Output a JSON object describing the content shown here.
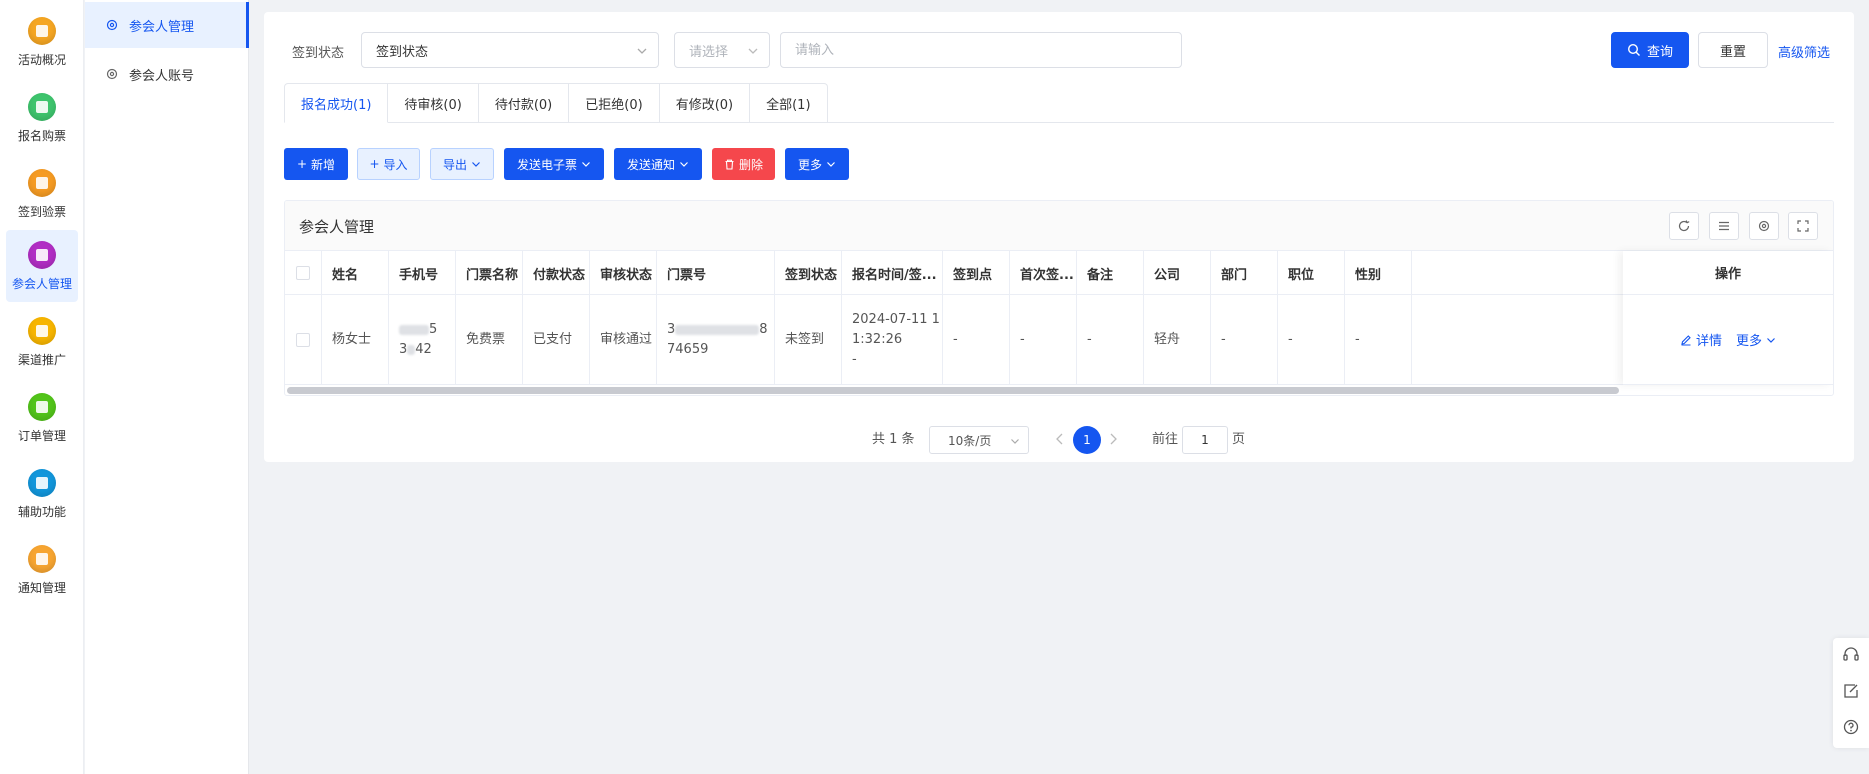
{
  "rail": {
    "items": [
      {
        "label": "活动概况",
        "color": "#f5a623",
        "active": false
      },
      {
        "label": "报名购票",
        "color": "#3ec46d",
        "active": false
      },
      {
        "label": "签到验票",
        "color": "#f59b23",
        "active": false
      },
      {
        "label": "参会人管理",
        "color": "#b12ec4",
        "active": true
      },
      {
        "label": "渠道推广",
        "color": "#f7b500",
        "active": false
      },
      {
        "label": "订单管理",
        "color": "#52c41a",
        "active": false
      },
      {
        "label": "辅助功能",
        "color": "#1296db",
        "active": false
      },
      {
        "label": "通知管理",
        "color": "#f7a531",
        "active": false
      }
    ]
  },
  "subnav": {
    "items": [
      {
        "label": "参会人管理",
        "active": true
      },
      {
        "label": "参会人账号",
        "active": false
      }
    ]
  },
  "filter": {
    "label": "签到状态",
    "status_select": "签到状态",
    "type_select": "请选择",
    "keyword_placeholder": "请输入",
    "search_label": "查询",
    "reset_label": "重置",
    "advanced_label": "高级筛选"
  },
  "tabs": [
    {
      "label": "报名成功(1)",
      "active": true
    },
    {
      "label": "待审核(0)",
      "active": false
    },
    {
      "label": "待付款(0)",
      "active": false
    },
    {
      "label": "已拒绝(0)",
      "active": false
    },
    {
      "label": "有修改(0)",
      "active": false
    },
    {
      "label": "全部(1)",
      "active": false
    }
  ],
  "toolbar": {
    "add": "新增",
    "import": "导入",
    "export": "导出",
    "send_ticket": "发送电子票",
    "send_notice": "发送通知",
    "delete": "删除",
    "more": "更多"
  },
  "table": {
    "title": "参会人管理",
    "columns": [
      "姓名",
      "手机号",
      "门票名称",
      "付款状态",
      "审核状态",
      "门票号",
      "签到状态",
      "报名时间/签...",
      "签到点",
      "首次签...",
      "备注",
      "公司",
      "部门",
      "职位",
      "性别"
    ],
    "action_header": "操作",
    "rows": [
      {
        "name": "杨女士",
        "phone_a": "5",
        "phone_b": "3",
        "phone_c": "42",
        "ticket_name": "免费票",
        "pay_status": "已支付",
        "review_status": "审核通过",
        "ticket_no_a": "3",
        "ticket_no_b": "8",
        "ticket_no_tail": "74659",
        "checkin_status": "未签到",
        "reg_time_1": "2024-07-11 1",
        "reg_time_2": "1:32:26",
        "reg_time_3": "-",
        "checkin_point": "-",
        "first_checkin": "-",
        "remark": "-",
        "company": "轻舟",
        "dept": "-",
        "position": "-",
        "gender": "-",
        "detail_label": "详情",
        "more_label": "更多"
      }
    ]
  },
  "pagination": {
    "total": "共 1 条",
    "page_size": "10条/页",
    "current_page": "1",
    "goto_prefix": "前往",
    "goto_value": "1",
    "goto_suffix": "页"
  }
}
